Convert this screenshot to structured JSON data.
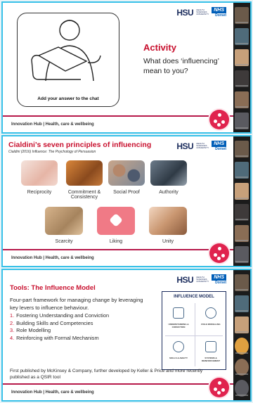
{
  "slides": [
    {
      "activity_title": "Activity",
      "question": "What does ‘influencing’ mean to you?",
      "prompt": "Add your answer to the chat",
      "footer": "Innovation Hub | Health, care & wellbeing"
    },
    {
      "title": "Cialdini’s seven principles of influencing",
      "subtitle": "Cialdini (2016) Influence: The Psychology of Persuasion",
      "principles": [
        "Reciprocity",
        "Commitment & Consistency",
        "Social Proof",
        "Authority",
        "Scarcity",
        "Liking",
        "Unity"
      ],
      "footer": "Innovation Hub | Health, care & wellbeing"
    },
    {
      "title": "Tools: The Influence Model",
      "intro": "Four-part framework for managing change by leveraging key levers to influence behaviour.",
      "points": [
        {
          "n": "1.",
          "text": "Fostering Understanding and Conviction"
        },
        {
          "n": "2.",
          "text": "Building Skills and Competencies"
        },
        {
          "n": "3.",
          "text": "Role Modelling"
        },
        {
          "n": "4.",
          "text": "Reinforcing with Formal Mechanism"
        }
      ],
      "model_title": "INFLUENCE MODEL",
      "model_labels": [
        "UNDERSTANDING & CONVICTION",
        "ROLE MODELLING",
        "SKILLS & ABILITY",
        "SYSTEMS & REINFORCEMENT"
      ],
      "note": "First published by McKinsey & Company, further developed by Keller & Price and more recently published as a QSIR tool",
      "footer": "Innovation Hub | Health, care & wellbeing"
    }
  ],
  "logo": {
    "hsu": "HSU",
    "hsu_sub": "HEALTH SCIENCES UNIVERSITY",
    "nhs": "NHS",
    "region": "Dorset"
  },
  "colors": {
    "accent": "#c8102e",
    "border": "#38c1e8",
    "nhs": "#005eb8",
    "hub": "#e0234e"
  }
}
